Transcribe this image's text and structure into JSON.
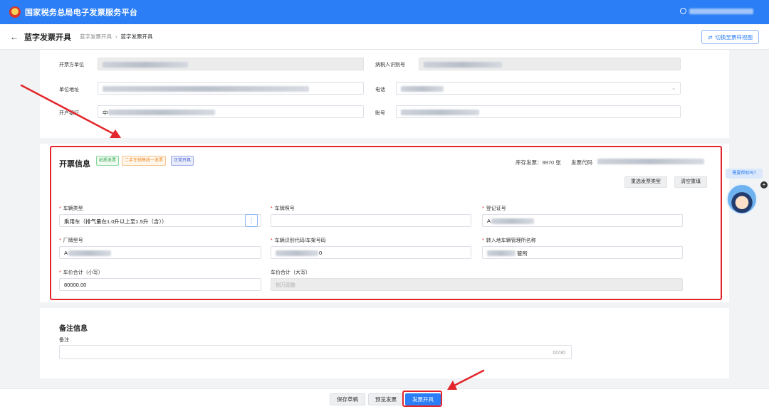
{
  "app": {
    "title": "国家税务总局电子发票服务平台"
  },
  "header": {
    "back_icon": "←",
    "title": "蓝字发票开具",
    "breadcrumb": [
      "蓝字发票开具",
      "蓝字发票开具"
    ],
    "switch_label": "切换至票样视图"
  },
  "seller": {
    "name_label": "开票方单位",
    "tax_id_label": "纳税人识别号",
    "address_label": "单位地址",
    "phone_label": "电话",
    "bank_label": "开户银行",
    "account_label": "账号",
    "bank_value_prefix": "中"
  },
  "invoice": {
    "title": "开票信息",
    "tags": [
      "纸质发票",
      "二手车销售统一发票",
      "正常开具"
    ],
    "stock_text": "库存发票：9970 张",
    "code_label": "发票代码",
    "reselect_label": "重选发票类型",
    "clear_label": "清空重填",
    "fields": {
      "vehicle_type": {
        "label": "车辆类型",
        "value": "乘用车（排气量在1.0升以上至1.5升（含））",
        "more": "⋮"
      },
      "plate_no": {
        "label": "车牌照号"
      },
      "reg_cert": {
        "label": "登记证号",
        "value": "A"
      },
      "model": {
        "label": "厂牌型号",
        "value": "A"
      },
      "vin": {
        "label": "车辆识别代码/车架号码",
        "value": "0"
      },
      "transfer_office": {
        "label": "转入地车辆管理所名称",
        "value": "管所"
      },
      "price_small": {
        "label": "车价合计（小写）",
        "value": "80000.00"
      },
      "price_big": {
        "label": "车价合计（大写）",
        "value": "捌万圆整"
      }
    }
  },
  "remark": {
    "title": "备注信息",
    "label": "备注",
    "counter": "0/230"
  },
  "actions": {
    "save_draft": "保存草稿",
    "preview": "预览发票",
    "issue": "发票开具"
  },
  "help": {
    "bubble": "需要帮助吗?"
  },
  "colors": {
    "primary": "#2b7ef5",
    "highlight": "#e3262b"
  }
}
